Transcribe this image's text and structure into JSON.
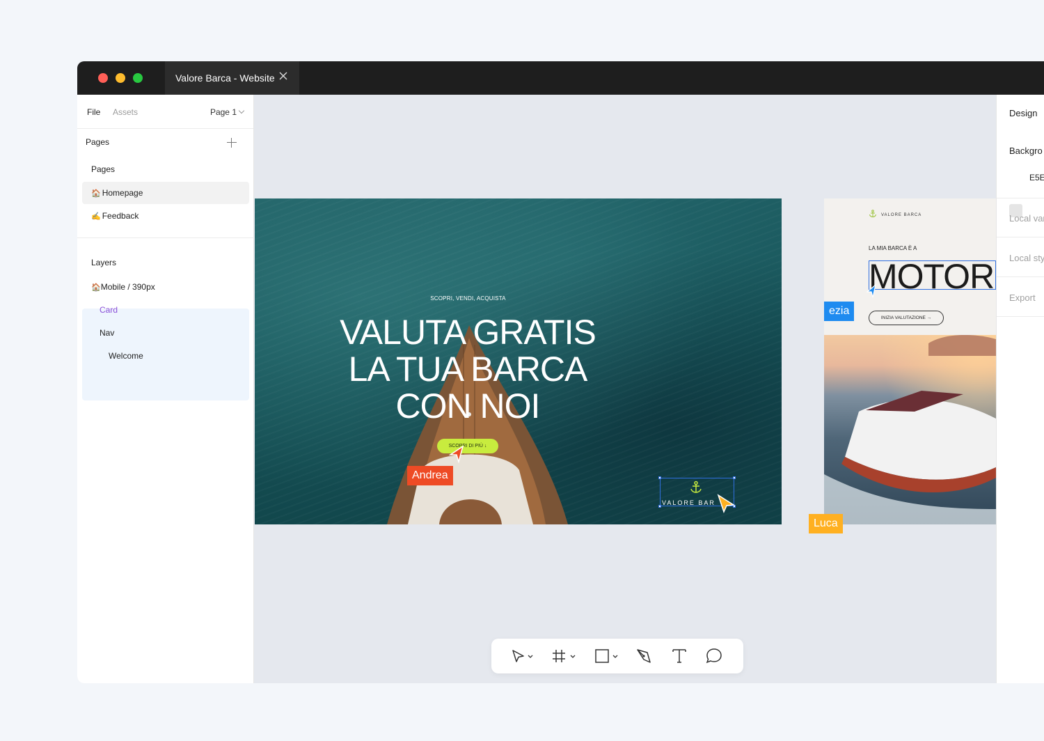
{
  "window": {
    "tab_title": "Valore Barca - Website"
  },
  "left_panel": {
    "file_label": "File",
    "assets_label": "Assets",
    "page_selector": "Page 1",
    "pages_header": "Pages",
    "pages_subheader": "Pages",
    "pages": [
      {
        "emoji": "🏠",
        "label": "Homepage",
        "selected": true
      },
      {
        "emoji": "✍️",
        "label": "Feedback",
        "selected": false
      }
    ],
    "layers_header": "Layers",
    "layers": [
      {
        "emoji": "🏠",
        "label": "Mobile / 390px"
      },
      {
        "label": "Card"
      },
      {
        "label": "Nav"
      },
      {
        "label": "Welcome"
      }
    ]
  },
  "canvas": {
    "main_frame": {
      "kicker": "SCOPRI, VENDI, ACQUISTA",
      "title_line1": "VALUTA GRATIS",
      "title_line2": "LA TUA BARCA",
      "title_line3": "CON NOI",
      "cta_label": "SCOPRI DI PIÙ ↓",
      "logo_text": "VALORE BAR"
    },
    "right_frame": {
      "brand": "VALORE BARCA",
      "kicker": "LA MIA BARCA È A",
      "title": "MOTOR",
      "button_label": "INIZIA VALUTAZIONE →"
    },
    "collaborators": [
      {
        "name": "Andrea",
        "color": "#ee4b25"
      },
      {
        "name": "Luca",
        "color": "#ffb021"
      },
      {
        "name": "ezia",
        "color": "#1e8bf0"
      }
    ]
  },
  "toolbar": {
    "tools": [
      "move-tool-icon",
      "frame-tool-icon",
      "shape-tool-icon",
      "pen-tool-icon",
      "text-tool-icon",
      "comment-tool-icon"
    ]
  },
  "right_panel": {
    "design_tab": "Design",
    "background_label": "Backgro",
    "background_value": "E5E",
    "local_variables": "Local var",
    "local_styles": "Local sty",
    "export": "Export"
  },
  "colors": {
    "accent_green": "#c8ec3e",
    "selection_blue": "#2f6fe0",
    "title_bar": "#1e1e1e"
  }
}
